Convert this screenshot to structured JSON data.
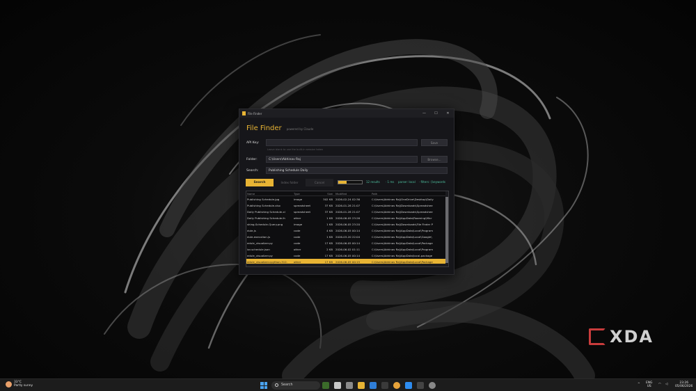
{
  "window": {
    "title": "File Finder",
    "controls": {
      "minimize": "—",
      "maximize": "☐",
      "close": "✕"
    }
  },
  "app": {
    "title": "File Finder",
    "subtitle": "powered by Claude"
  },
  "form": {
    "api_key_label": "API Key:",
    "api_key_value": "",
    "api_key_hint": "Leave blank to use the built-in session token",
    "save_label": "Save",
    "folder_label": "Folder:",
    "folder_value": "C:\\Users\\Abhinav Raj",
    "browse_label": "Browse...",
    "search_label": "Search:",
    "search_value": "Publishing Schedule Daily"
  },
  "actions": {
    "search": "Search",
    "index_folder": "Index folder",
    "cancel": "Cancel"
  },
  "progress": {
    "value": 0.35
  },
  "status": {
    "results": "12 results",
    "time": "· 1 ms",
    "parser": "parser: local",
    "filters": "· filters: {keywords"
  },
  "table": {
    "columns": [
      "Name",
      "Type",
      "Size",
      "Modified",
      "Path"
    ],
    "rows": [
      {
        "name": "Publishing Schedule.jpg",
        "type": "image",
        "size": "302 KB",
        "modified": "2026-02-24 02:36",
        "path": "C:\\Users\\Abhinav Raj\\OneDrive\\Desktop\\Daily"
      },
      {
        "name": "Publishing Schedule.xlsx",
        "type": "spreadsheet",
        "size": "37 KB",
        "modified": "2026-01-28 21:07",
        "path": "C:\\Users\\Abhinav Raj\\Downloads\\Spreadshee"
      },
      {
        "name": "Daily Publishing Schedule.xl",
        "type": "spreadsheet",
        "size": "37 KB",
        "modified": "2026-01-28 21:07",
        "path": "C:\\Users\\Abhinav Raj\\Downloads\\Spreadshee"
      },
      {
        "name": "Daily Publishing Schedule.lh",
        "type": "other",
        "size": "1 KB",
        "modified": "2026-06-05 23:26",
        "path": "C:\\Users\\Abhinav Raj\\AppData\\Roaming\\Micr"
      },
      {
        "name": "shing-Schedule-Query.png",
        "type": "image",
        "size": "1 KB",
        "modified": "2026-06-05 23:20",
        "path": "C:\\Users\\Abhinav Raj\\Downloads\\File Finder P"
      },
      {
        "name": "dule.js",
        "type": "code",
        "size": "4 KB",
        "modified": "2026-06-05 00:14",
        "path": "C:\\Users\\Abhinav Raj\\AppData\\Local\\Program"
      },
      {
        "name": "dule-execution.js",
        "type": "code",
        "size": "1 KB",
        "modified": "2026-03-20 22:04",
        "path": "C:\\Users\\Abhinav Raj\\AppData\\Local\\Google\\"
      },
      {
        "name": "edule_visualizer.py",
        "type": "code",
        "size": "17 KB",
        "modified": "2026-06-05 00:14",
        "path": "C:\\Users\\Abhinav Raj\\AppData\\Local\\Package"
      },
      {
        "name": "ior-schedule.json",
        "type": "other",
        "size": "2 KB",
        "modified": "2026-06-02 01:11",
        "path": "C:\\Users\\Abhinav Raj\\AppData\\Local\\Program"
      },
      {
        "name": "edule_visualizer.py",
        "type": "code",
        "size": "17 KB",
        "modified": "2026-06-05 00:14",
        "path": "C:\\Users\\Abhinav Raj\\AppData\\local-package"
      },
      {
        "name": "edule_visualizer.cpython-312.",
        "type": "other",
        "size": "17 KB",
        "modified": "2026-06-05 00:15",
        "path": "C:\\Users\\Abhinav Raj\\AppData\\Local\\Package"
      }
    ],
    "selected_index": 10
  },
  "watermark": {
    "text": "XDA"
  },
  "taskbar": {
    "weather_temp": "33°C",
    "weather_desc": "Partly sunny",
    "search_placeholder": "Search",
    "lang_top": "ENG",
    "lang_bottom": "US",
    "time": "23:26",
    "date": "05/06/2026"
  }
}
